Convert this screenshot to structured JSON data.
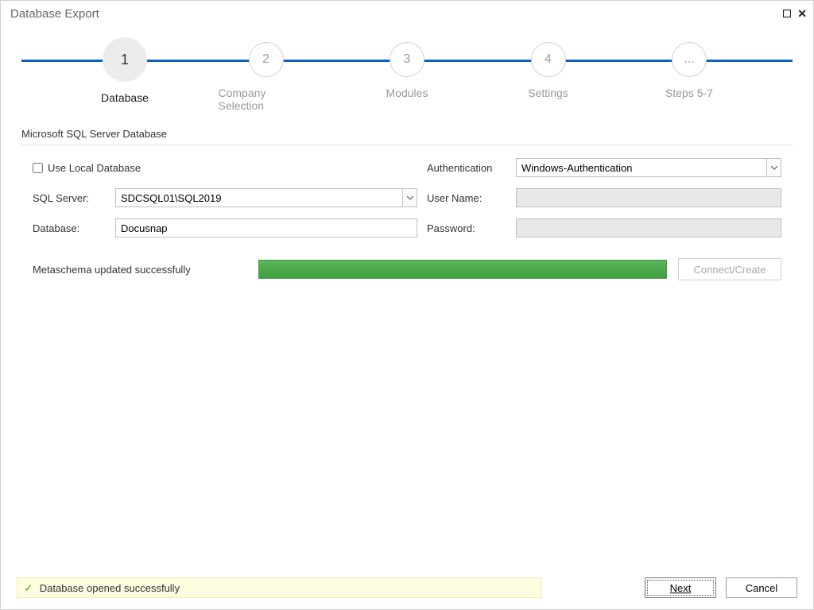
{
  "window": {
    "title": "Database Export"
  },
  "wizard": {
    "steps": [
      {
        "num": "1",
        "label": "Database",
        "active": true
      },
      {
        "num": "2",
        "label": "Company Selection",
        "active": false
      },
      {
        "num": "3",
        "label": "Modules",
        "active": false
      },
      {
        "num": "4",
        "label": "Settings",
        "active": false
      },
      {
        "num": "...",
        "label": "Steps 5-7",
        "active": false
      }
    ]
  },
  "section": {
    "title": "Microsoft SQL Server Database"
  },
  "form": {
    "use_local_db_label": "Use Local Database",
    "use_local_db_checked": false,
    "sql_server_label": "SQL Server:",
    "sql_server_value": "SDCSQL01\\SQL2019",
    "database_label": "Database:",
    "database_value": "Docusnap",
    "auth_label": "Authentication",
    "auth_value": "Windows-Authentication",
    "username_label": "User Name:",
    "username_value": "",
    "password_label": "Password:",
    "password_value": ""
  },
  "progress": {
    "label": "Metaschema updated successfully",
    "connect_button": "Connect/Create"
  },
  "status": {
    "text": "Database opened successfully"
  },
  "footer": {
    "next": "Next",
    "cancel": "Cancel"
  }
}
